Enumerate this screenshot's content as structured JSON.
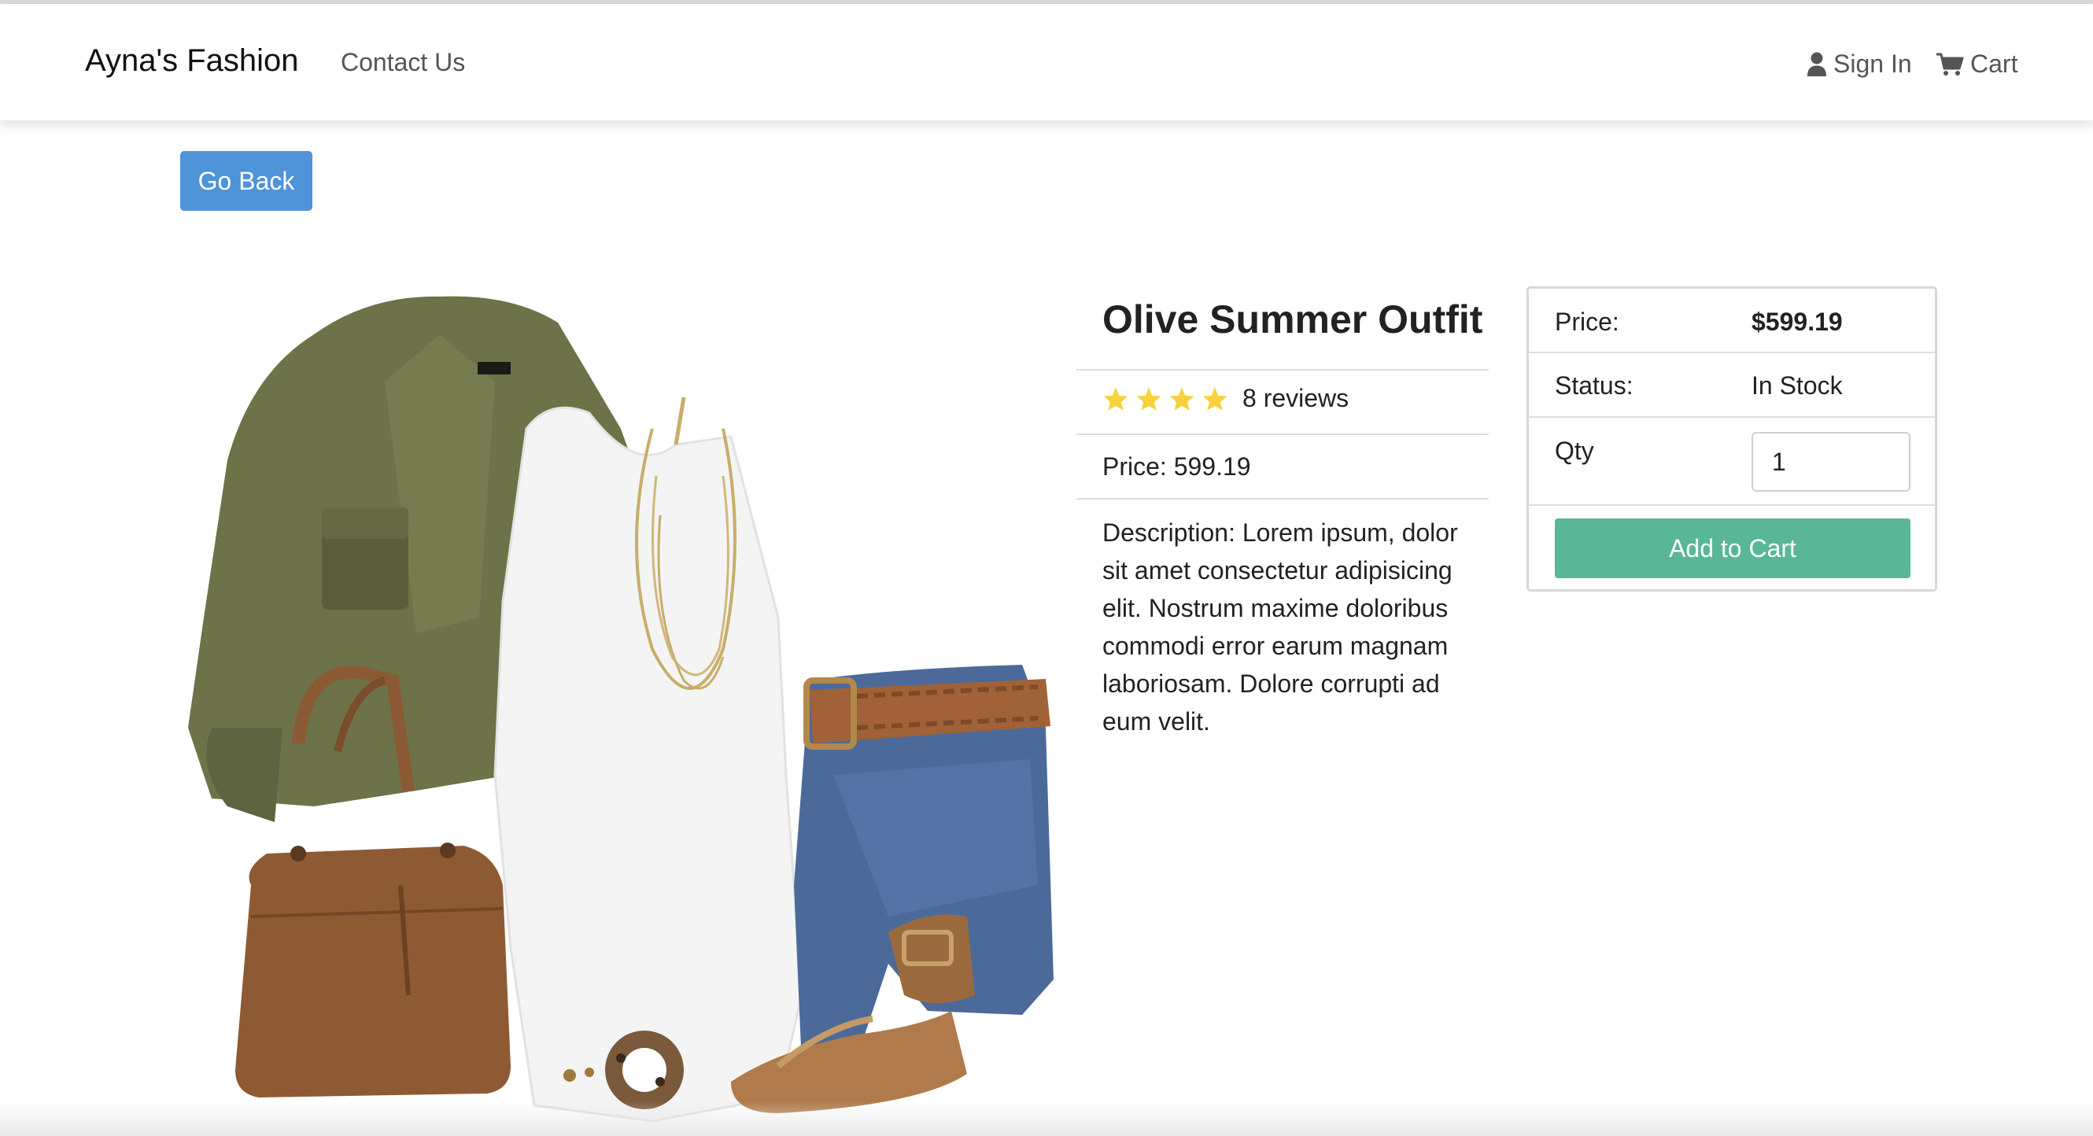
{
  "navbar": {
    "brand": "Ayna's Fashion",
    "contact": "Contact Us",
    "signin": "Sign In",
    "cart": "Cart"
  },
  "go_back_label": "Go Back",
  "product": {
    "name": "Olive Summer Outfit",
    "rating_stars": 4,
    "reviews_text": "8 reviews",
    "price_line": "Price: 599.19",
    "description": "Description: Lorem ipsum, dolor sit amet consectetur adipisicing elit. Nostrum maxime doloribus commodi error earum magnam laboriosam. Dolore corrupti ad eum velit.",
    "image_icon": "outfit-photo"
  },
  "purchase_card": {
    "price_label": "Price:",
    "price_value": "$599.19",
    "status_label": "Status:",
    "status_value": "In Stock",
    "qty_label": "Qty",
    "qty_value": "1",
    "add_to_cart": "Add to Cart"
  },
  "colors": {
    "go_back": "#4f93d9",
    "add_to_cart": "#59b797",
    "star": "#f7d23e"
  }
}
